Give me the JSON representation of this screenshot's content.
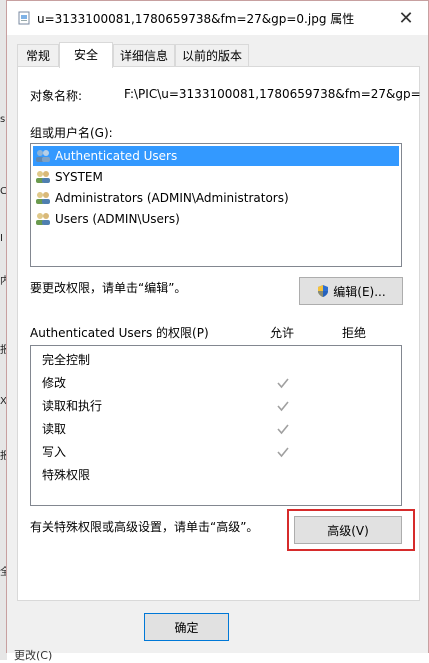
{
  "window": {
    "title": "u=3133100081,1780659738&fm=27&gp=0.jpg 属性",
    "close_glyph": "✕"
  },
  "tabs": [
    {
      "label": "常规",
      "active": false
    },
    {
      "label": "安全",
      "active": true
    },
    {
      "label": "详细信息",
      "active": false
    },
    {
      "label": "以前的版本",
      "active": false
    }
  ],
  "object_name": {
    "label": "对象名称:",
    "value": "F:\\PIC\\u=3133100081,1780659738&fm=27&gp="
  },
  "groups": {
    "label": "组或用户名(G):",
    "items": [
      {
        "label": "Authenticated Users",
        "selected": true
      },
      {
        "label": "SYSTEM",
        "selected": false
      },
      {
        "label": "Administrators (ADMIN\\Administrators)",
        "selected": false
      },
      {
        "label": "Users (ADMIN\\Users)",
        "selected": false
      }
    ]
  },
  "edit": {
    "hint": "要更改权限，请单击“编辑”。",
    "button_label": "编辑(E)..."
  },
  "permissions": {
    "title": "Authenticated Users 的权限(P)",
    "allow_header": "允许",
    "deny_header": "拒绝",
    "rows": [
      {
        "name": "完全控制",
        "allow": false
      },
      {
        "name": "修改",
        "allow": true
      },
      {
        "name": "读取和执行",
        "allow": true
      },
      {
        "name": "读取",
        "allow": true
      },
      {
        "name": "写入",
        "allow": true
      },
      {
        "name": "特殊权限",
        "allow": false
      }
    ]
  },
  "advanced": {
    "hint": "有关特殊权限或高级设置，请单击“高级”。",
    "button_label": "高级(V)"
  },
  "footer": {
    "ok_label": "确定"
  },
  "background_app": {
    "left_marks": [
      "s",
      "C",
      "I",
      "内",
      "报",
      "X",
      "报",
      "全"
    ],
    "bottom_text": "更改(C)"
  },
  "colors": {
    "selection": "#3399ff",
    "highlight_frame": "#d62b2b",
    "check_mark": "#a0a0a0"
  },
  "icons": {
    "file_icon": "document-icon",
    "user_icon": "users-group-icon",
    "shield_icon": "uac-shield-icon",
    "check_icon": "check-mark-icon"
  }
}
